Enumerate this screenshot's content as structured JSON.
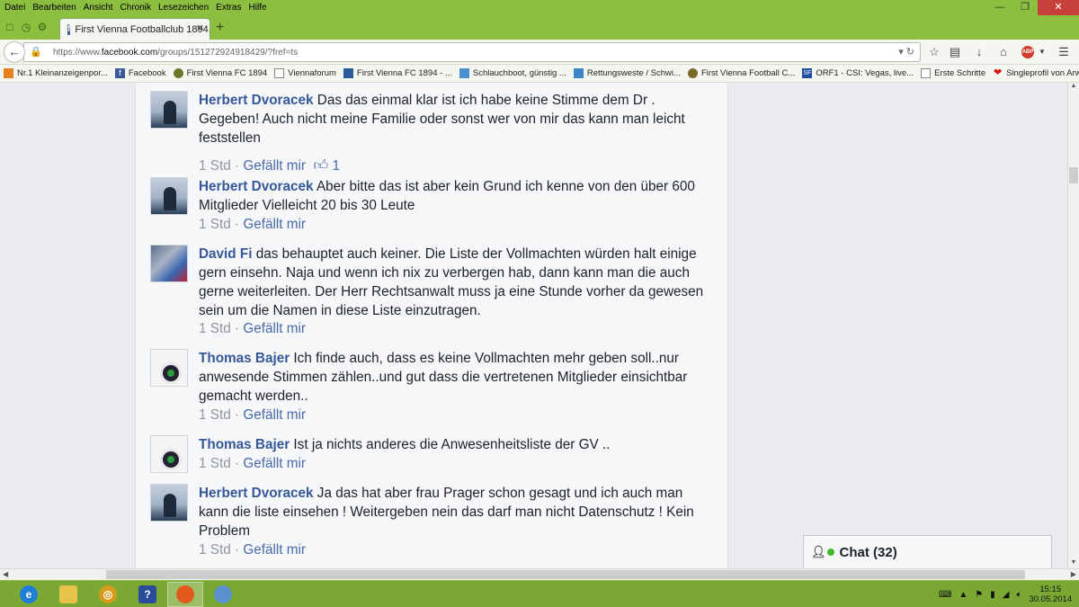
{
  "menu": [
    "Datei",
    "Bearbeiten",
    "Ansicht",
    "Chronik",
    "Lesezeichen",
    "Extras",
    "Hilfe"
  ],
  "tab": {
    "title": "First Vienna Footballclub 1894..."
  },
  "url": {
    "prefix": "https://www.",
    "host": "facebook.com",
    "path": "/groups/151272924918429/?fref=ts"
  },
  "bookmarks": [
    {
      "label": "Nr.1 Kleinanzeigenpor...",
      "icon": "orange-bookmark-icon"
    },
    {
      "label": "Facebook",
      "icon": "facebook-icon"
    },
    {
      "label": "First Vienna FC 1894",
      "icon": "club-icon"
    },
    {
      "label": "Viennaforum",
      "icon": "page-icon"
    },
    {
      "label": "First Vienna FC 1894 - ...",
      "icon": "club-icon"
    },
    {
      "label": "Schlauchboot, günstig ...",
      "icon": "boat-icon"
    },
    {
      "label": "Rettungsweste / Schwi...",
      "icon": "vest-icon"
    },
    {
      "label": "First Vienna Football C...",
      "icon": "club-icon"
    },
    {
      "label": "ORF1 - CSI: Vegas, live...",
      "icon": "tv-icon"
    },
    {
      "label": "Erste Schritte",
      "icon": "page-icon"
    },
    {
      "label": "Singleprofil von Arwen_",
      "icon": "heart-icon"
    }
  ],
  "comments": [
    {
      "author": "Herbert Dvoracek",
      "text": "Das das einmal klar ist ich habe keine Stimme dem Dr . Gegeben! Auch nicht meine Familie oder sonst wer von mir das kann man leicht feststellen",
      "time": "1 Std",
      "like": "Gefällt mir",
      "likes": "1",
      "avatar": "hd"
    },
    {
      "author": "Herbert Dvoracek",
      "text": "Aber bitte das ist aber kein Grund ich kenne von den über 600 Mitglieder Vielleicht 20 bis 30 Leute",
      "time": "1 Std",
      "like": "Gefällt mir",
      "avatar": "hd"
    },
    {
      "author": "David Fi",
      "text": "das behauptet auch keiner. Die Liste der Vollmachten würden halt einige gern einsehn. Naja und wenn ich nix zu verbergen hab, dann kann man die auch gerne weiterleiten. Der Herr Rechtsanwalt muss ja eine Stunde vorher da gewesen sein um die Namen in diese Liste einzutragen.",
      "time": "1 Std",
      "like": "Gefällt mir",
      "avatar": "df"
    },
    {
      "author": "Thomas Bajer",
      "text": "Ich finde auch, dass es keine Vollmachten mehr geben soll..nur anwesende Stimmen zählen..und gut dass die vertretenen Mitglieder einsichtbar gemacht werden..",
      "time": "1 Std",
      "like": "Gefällt mir",
      "avatar": "tb"
    },
    {
      "author": "Thomas Bajer",
      "text": "Ist ja nichts anderes die Anwesenheitsliste der GV ..",
      "time": "1 Std",
      "like": "Gefällt mir",
      "avatar": "tb"
    },
    {
      "author": "Herbert Dvoracek",
      "text": "Ja das hat aber frau Prager schon gesagt und ich auch man kann die liste einsehen ! Weitergeben nein das darf man nicht Datenschutz ! Kein Problem",
      "time": "1 Std",
      "like": "Gefällt mir",
      "avatar": "hd"
    }
  ],
  "separator": " · ",
  "chat": {
    "label": "Chat (32)"
  },
  "clock": {
    "time": "15:15",
    "date": "30.05.2014"
  }
}
